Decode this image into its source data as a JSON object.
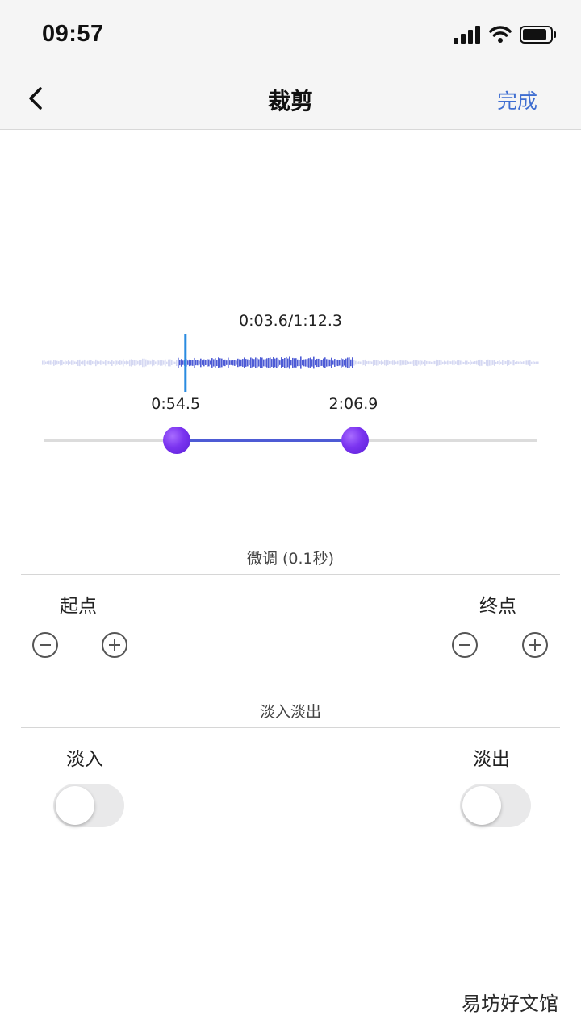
{
  "status_bar": {
    "time": "09:57"
  },
  "nav": {
    "title": "裁剪",
    "done_label": "完成",
    "back_icon": "chevron-left-icon"
  },
  "player": {
    "current_time": "0:03.6/1:12.3",
    "start_mark": "0:54.5",
    "end_mark": "2:06.9",
    "selection_start_fraction": 0.27,
    "selection_end_fraction": 0.63,
    "playhead_fraction": 0.29
  },
  "fine_tune": {
    "title": "微调 (0.1秒)",
    "start_label": "起点",
    "end_label": "终点"
  },
  "fade": {
    "title": "淡入淡出",
    "fade_in_label": "淡入",
    "fade_out_label": "淡出",
    "fade_in_on": false,
    "fade_out_on": false
  },
  "watermark": "易坊好文馆",
  "colors": {
    "accent": "#3f6ed1",
    "wave_active": "#4d5bd5",
    "wave_inactive": "#d5d8f2",
    "playhead": "#2a8be0",
    "knob": "#7b34f0"
  }
}
